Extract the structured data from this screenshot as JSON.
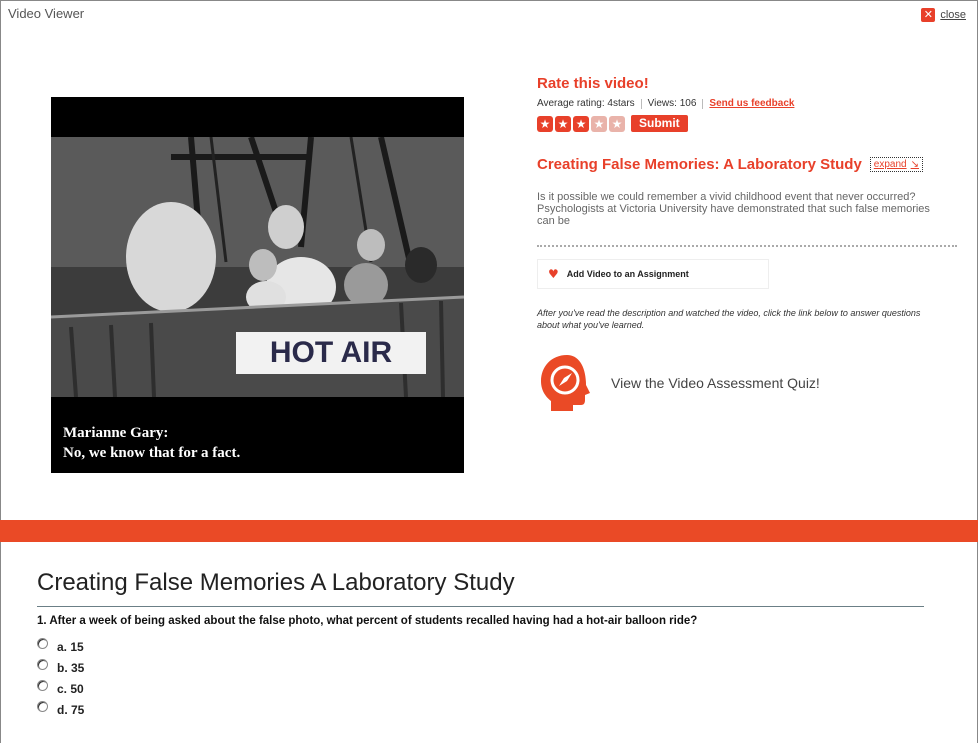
{
  "window": {
    "title": "Video Viewer",
    "close_label": "close",
    "close_icon": "close-icon"
  },
  "video": {
    "sign_text": "HOT AIR",
    "caption_line1": "Marianne Gary:",
    "caption_line2": "No, we know that for a fact."
  },
  "rating": {
    "title": "Rate this video!",
    "average": "Average rating: 4stars",
    "views": "Views: 106",
    "feedback_label": "Send us feedback",
    "stars": [
      true,
      true,
      true,
      false,
      false
    ],
    "submit_label": "Submit"
  },
  "info": {
    "title": "Creating False Memories: A Laboratory Study",
    "expand_label": "expand",
    "description": "Is it possible we could remember a vivid childhood event that never occurred? Psychologists at Victoria University have demonstrated that such false memories can be"
  },
  "assignment": {
    "label": "Add Video to an Assignment"
  },
  "instructions": "After you've read the description and watched the video, click the link below to answer questions about what you've learned.",
  "quiz_link": "View the Video Assessment Quiz!",
  "quiz": {
    "title": "Creating False Memories A Laboratory Study",
    "question": "1. After a week of being asked about the false photo, what percent of students recalled having had a hot-air balloon ride?",
    "options": [
      "a. 15",
      "b. 35",
      "c. 50",
      "d. 75"
    ]
  },
  "colors": {
    "accent": "#e8402a",
    "band": "#ea4a26"
  }
}
